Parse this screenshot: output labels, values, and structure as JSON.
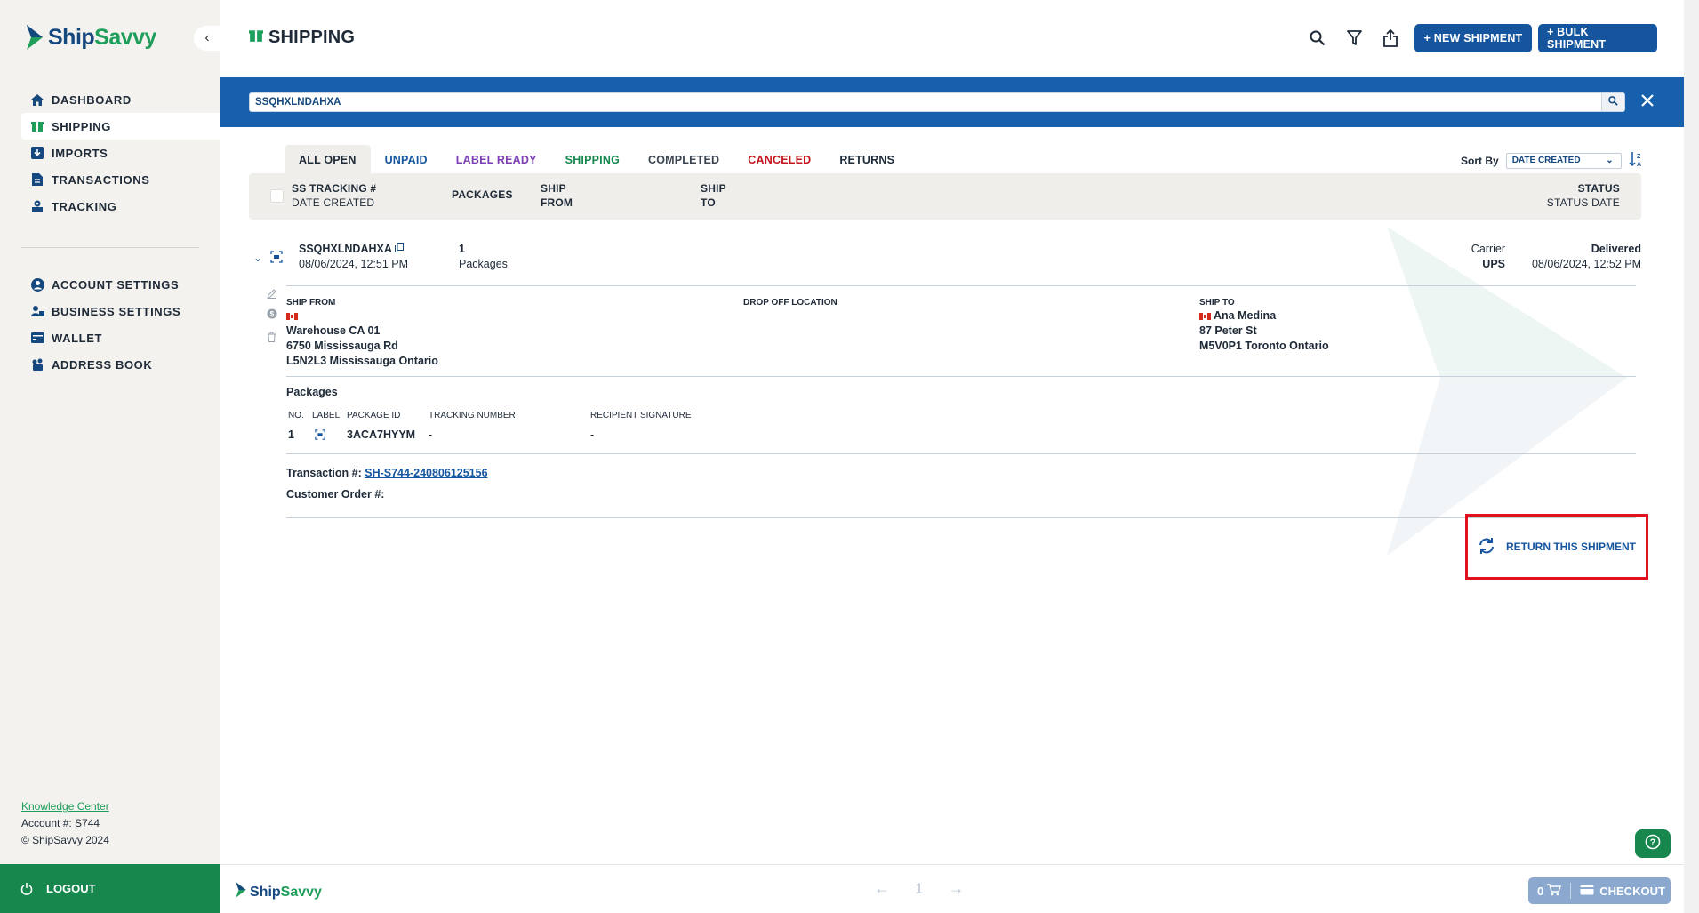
{
  "app": {
    "name_part1": "Ship",
    "name_part2": "Savvy"
  },
  "sidebar": {
    "items": [
      {
        "label": "DASHBOARD",
        "icon": "home-icon"
      },
      {
        "label": "SHIPPING",
        "icon": "package-icon",
        "active": true
      },
      {
        "label": "IMPORTS",
        "icon": "import-icon"
      },
      {
        "label": "TRANSACTIONS",
        "icon": "document-icon"
      },
      {
        "label": "TRACKING",
        "icon": "tracking-icon"
      }
    ],
    "items2": [
      {
        "label": "ACCOUNT SETTINGS",
        "icon": "user-circle-icon"
      },
      {
        "label": "BUSINESS SETTINGS",
        "icon": "business-icon"
      },
      {
        "label": "WALLET",
        "icon": "wallet-icon"
      },
      {
        "label": "ADDRESS BOOK",
        "icon": "address-book-icon"
      }
    ],
    "knowledge_center": "Knowledge Center",
    "account": "Account #: S744",
    "copyright": "© ShipSavvy 2024",
    "logout": "LOGOUT"
  },
  "header": {
    "title": "SHIPPING",
    "new_shipment": "+ NEW SHIPMENT",
    "bulk_shipment": "+ BULK SHIPMENT"
  },
  "search": {
    "value": "SSQHXLNDAHXA"
  },
  "tabs": [
    {
      "label": "ALL OPEN",
      "color": "#1e2a38"
    },
    {
      "label": "UNPAID",
      "color": "#15559e"
    },
    {
      "label": "LABEL READY",
      "color": "#7b3fb3"
    },
    {
      "label": "SHIPPING",
      "color": "#17874e"
    },
    {
      "label": "COMPLETED",
      "color": "#3a4450"
    },
    {
      "label": "CANCELED",
      "color": "#c4141d"
    },
    {
      "label": "RETURNS",
      "color": "#1e2a38"
    }
  ],
  "sort": {
    "label": "Sort By",
    "value": "DATE CREATED"
  },
  "table_header": {
    "tracking": "SS TRACKING #",
    "date_created": "DATE CREATED",
    "packages": "PACKAGES",
    "ship": "SHIP",
    "from": "FROM",
    "ship2": "SHIP",
    "to": "TO",
    "status": "STATUS",
    "status_date": "STATUS DATE"
  },
  "shipment": {
    "tracking": "SSQHXLNDAHXA",
    "date_created": "08/06/2024, 12:51 PM",
    "package_count": "1",
    "packages_label": "Packages",
    "carrier_label": "Carrier",
    "carrier": "UPS",
    "status": "Delivered",
    "status_date": "08/06/2024, 12:52 PM",
    "ship_from_label": "SHIP FROM",
    "ship_from": [
      "Warehouse CA 01",
      "6750 Mississauga Rd",
      "L5N2L3 Mississauga Ontario"
    ],
    "drop_off_label": "DROP OFF LOCATION",
    "ship_to_label": "SHIP TO",
    "ship_to_name": "Ana Medina",
    "ship_to": [
      "87 Peter St",
      "M5V0P1 Toronto Ontario"
    ],
    "packages_title": "Packages",
    "pkg_headers": {
      "no": "NO.",
      "label": "LABEL",
      "package_id": "PACKAGE ID",
      "tracking_number": "TRACKING NUMBER",
      "recipient_signature": "RECIPIENT SIGNATURE"
    },
    "pkg_row": {
      "no": "1",
      "package_id": "3ACA7HYYM",
      "tracking_number": "-",
      "recipient_signature": "-"
    },
    "transaction_label": "Transaction #:",
    "transaction": "SH-S744-240806125156",
    "customer_order_label": "Customer Order #:",
    "return_label": "RETURN THIS SHIPMENT"
  },
  "bottom": {
    "page": "1",
    "cart_count": "0",
    "checkout": "CHECKOUT"
  }
}
